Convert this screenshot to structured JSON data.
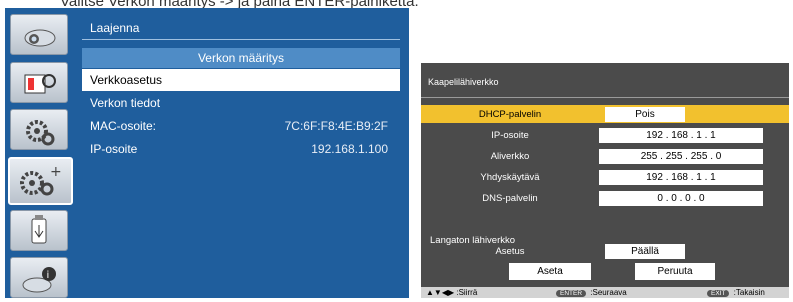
{
  "crop_caption": "Valitse Verkon määritys -> ja paina ENTER-painiketta.",
  "left": {
    "header": "Laajenna",
    "title": "Verkon määritys",
    "items": [
      {
        "label": "Verkkoasetus",
        "value": "",
        "selected": true
      },
      {
        "label": "Verkon tiedot",
        "value": "",
        "selected": false
      },
      {
        "label": "MAC-osoite:",
        "value": "7C:6F:F8:4E:B9:2F",
        "selected": false
      },
      {
        "label": "IP-osoite",
        "value": "192.168.1.100",
        "selected": false
      }
    ],
    "sidebar_icons": [
      "display-icon",
      "picture-settings-icon",
      "gears-icon",
      "network-settings-icon",
      "usb-icon",
      "info-icon"
    ],
    "active_icon": "network-settings-icon"
  },
  "right": {
    "header": "Kaapelilähiverkko",
    "rows": [
      {
        "label": "DHCP-palvelin",
        "value": "Pois"
      },
      {
        "label": "IP-osoite",
        "value": "192 . 168 .   1 . 1"
      },
      {
        "label": "Aliverkko",
        "value": "255 . 255 . 255 . 0"
      },
      {
        "label": "Yhdyskäytävä",
        "value": "192 . 168 .   1 . 1"
      },
      {
        "label": "DNS-palvelin",
        "value": "0   .   0   .   0 . 0"
      }
    ],
    "wireless_label": "Langaton lähiverkko",
    "wireless_setting_label": "Asetus",
    "wireless_setting_value": "Päällä",
    "apply_button": "Aseta",
    "cancel_button": "Peruuta",
    "footer": {
      "move_label": "Siirrä",
      "move_keys": "▲▼◀▶",
      "enter_key": "ENTER",
      "enter_label": "Seuraava",
      "exit_key": "EXIT",
      "exit_label": "Takaisin"
    }
  },
  "colors": {
    "left_panel": "#1f5e9d",
    "title_bar": "#4f8cc6",
    "right_panel": "#4b4b4b",
    "highlight": "#f2c12e"
  }
}
